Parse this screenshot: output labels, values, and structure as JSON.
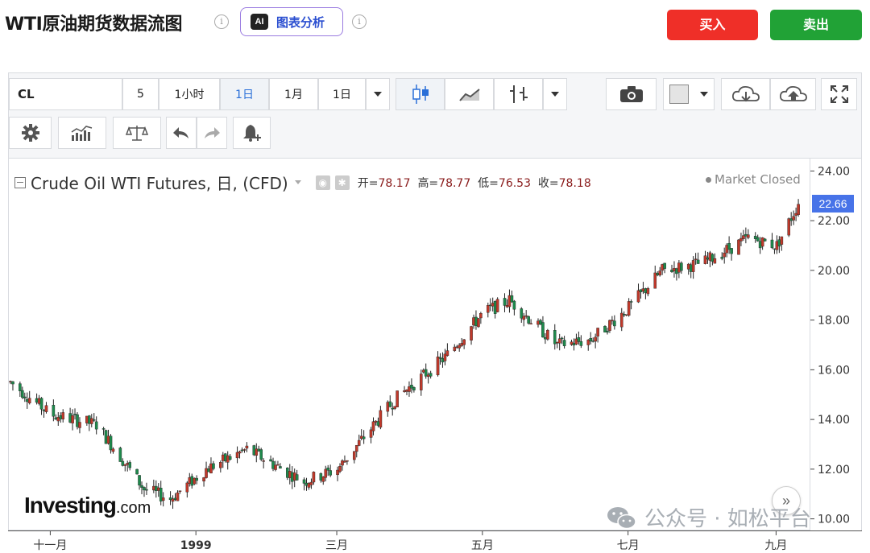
{
  "header": {
    "title": "WTI原油期货数据流图",
    "ai_badge": "AI",
    "ai_label": "图表分析",
    "buy_label": "买入",
    "sell_label": "卖出",
    "info_glyph": "i"
  },
  "toolbar": {
    "symbol": "CL",
    "intervals": [
      "5",
      "1小时",
      "1日",
      "1月",
      "1日"
    ],
    "active_interval_index": 2,
    "icons": [
      "candlestick-icon",
      "line-chart-icon",
      "bar-chart-icon",
      "camera-icon",
      "color-square-icon",
      "cloud-download-icon",
      "cloud-upload-icon",
      "fullscreen-icon",
      "settings-icon",
      "indicators-icon",
      "compare-scales-icon",
      "undo-icon",
      "redo-icon",
      "alert-bell-icon"
    ]
  },
  "legend": {
    "title": "Crude Oil WTI Futures, 日, (CFD)",
    "open_label": "开=",
    "open": "78.17",
    "high_label": "高=",
    "high": "78.77",
    "low_label": "低=",
    "low": "76.53",
    "close_label": "收=",
    "close": "78.18",
    "market_status": "Market Closed"
  },
  "logo": {
    "main": "Investing",
    "suffix": ".com"
  },
  "scroll_glyph": "»",
  "watermark": "公众号 · 如松平台",
  "last_price": "22.66",
  "colors": {
    "up": "#c0392b",
    "down": "#1e8a4c",
    "buy": "#ef2f28",
    "sell": "#21a236",
    "price_tag": "#4773e8"
  },
  "chart_data": {
    "type": "candlestick",
    "title": "Crude Oil WTI Futures, 日, (CFD)",
    "ylim": [
      9.5,
      24.5
    ],
    "y_ticks": [
      "24.00",
      "22.00",
      "20.00",
      "18.00",
      "16.00",
      "14.00",
      "12.00",
      "10.00"
    ],
    "x_ticks": [
      "十一月",
      "1999",
      "三月",
      "五月",
      "七月",
      "九月"
    ],
    "approx_close_path": [
      {
        "x": "1998-10-15",
        "y": 15.5
      },
      {
        "x": "1998-11-01",
        "y": 14.2
      },
      {
        "x": "1998-11-20",
        "y": 13.8
      },
      {
        "x": "1998-12-10",
        "y": 11.2
      },
      {
        "x": "1998-12-21",
        "y": 10.8
      },
      {
        "x": "1999-01-05",
        "y": 12.0
      },
      {
        "x": "1999-01-22",
        "y": 12.8
      },
      {
        "x": "1999-02-15",
        "y": 11.5
      },
      {
        "x": "1999-03-01",
        "y": 12.0
      },
      {
        "x": "1999-03-25",
        "y": 14.8
      },
      {
        "x": "1999-04-15",
        "y": 16.5
      },
      {
        "x": "1999-05-01",
        "y": 18.3
      },
      {
        "x": "1999-05-12",
        "y": 18.8
      },
      {
        "x": "1999-06-01",
        "y": 17.0
      },
      {
        "x": "1999-06-15",
        "y": 17.2
      },
      {
        "x": "1999-07-01",
        "y": 18.5
      },
      {
        "x": "1999-07-15",
        "y": 20.0
      },
      {
        "x": "1999-08-01",
        "y": 20.3
      },
      {
        "x": "1999-08-20",
        "y": 21.3
      },
      {
        "x": "1999-09-01",
        "y": 21.0
      },
      {
        "x": "1999-09-10",
        "y": 22.7
      }
    ]
  }
}
